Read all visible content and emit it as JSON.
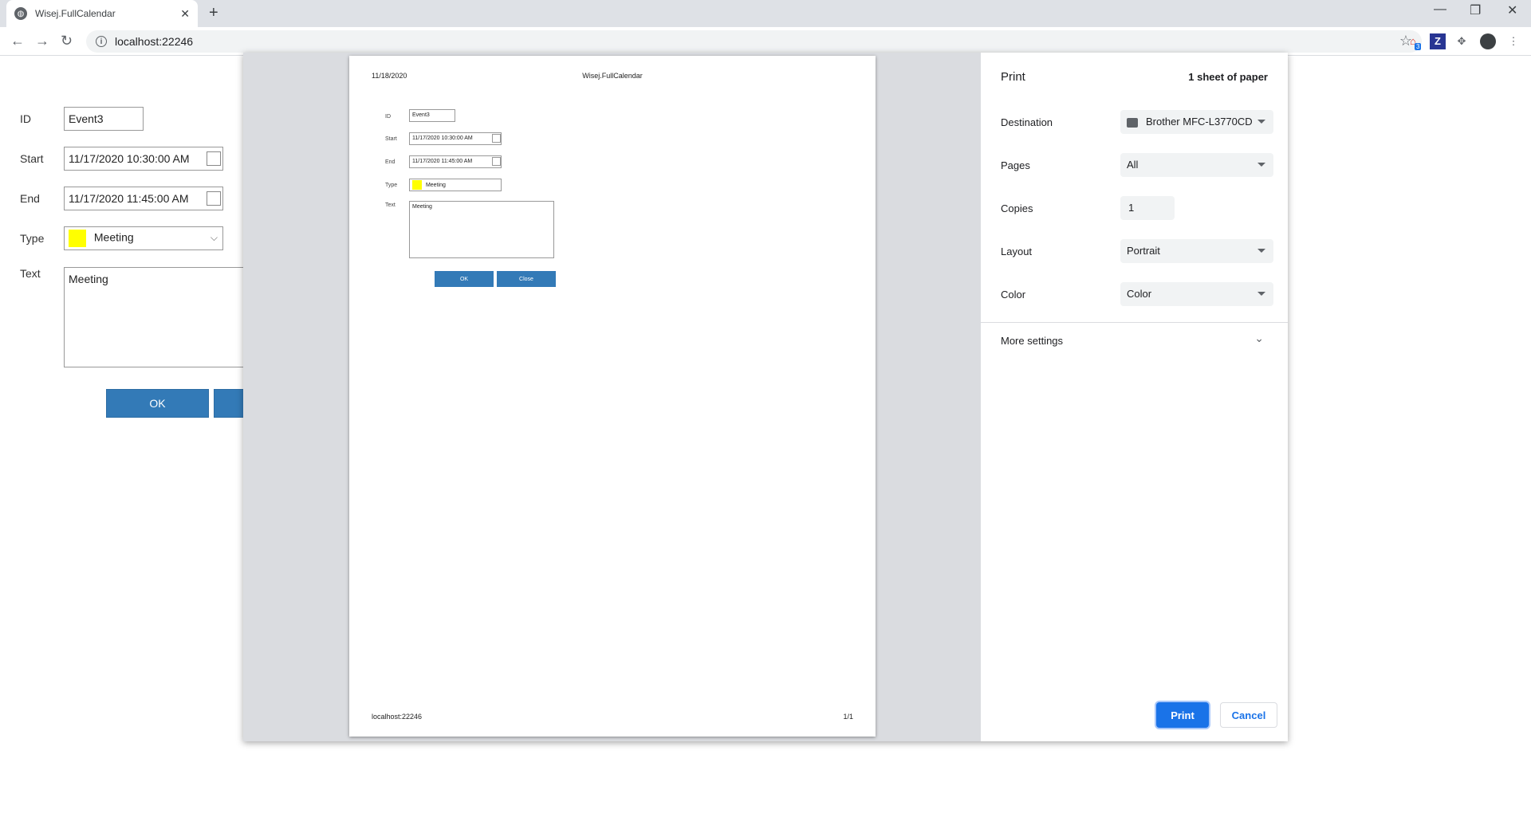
{
  "browser": {
    "tab_title": "Wisej.FullCalendar",
    "url": "localhost:22246",
    "extension_badge": "3"
  },
  "form": {
    "id_label": "ID",
    "id_value": "Event3",
    "start_label": "Start",
    "start_value": "11/17/2020 10:30:00 AM",
    "end_label": "End",
    "end_value": "11/17/2020 11:45:00 AM",
    "type_label": "Type",
    "type_value": "Meeting",
    "text_label": "Text",
    "text_value": "Meeting",
    "ok_label": "OK",
    "close_label": "Close"
  },
  "preview": {
    "header_date": "11/18/2020",
    "header_title": "Wisej.FullCalendar",
    "footer_url": "localhost:22246",
    "footer_page": "1/1"
  },
  "print": {
    "title": "Print",
    "sheets": "1 sheet of paper",
    "destination_label": "Destination",
    "destination_value": "Brother MFC-L3770CD",
    "pages_label": "Pages",
    "pages_value": "All",
    "copies_label": "Copies",
    "copies_value": "1",
    "layout_label": "Layout",
    "layout_value": "Portrait",
    "color_label": "Color",
    "color_value": "Color",
    "more_settings": "More settings",
    "print_button": "Print",
    "cancel_button": "Cancel"
  },
  "colors": {
    "accent": "#1a73e8",
    "form_button": "#337ab7",
    "type_swatch": "#ffff00"
  }
}
